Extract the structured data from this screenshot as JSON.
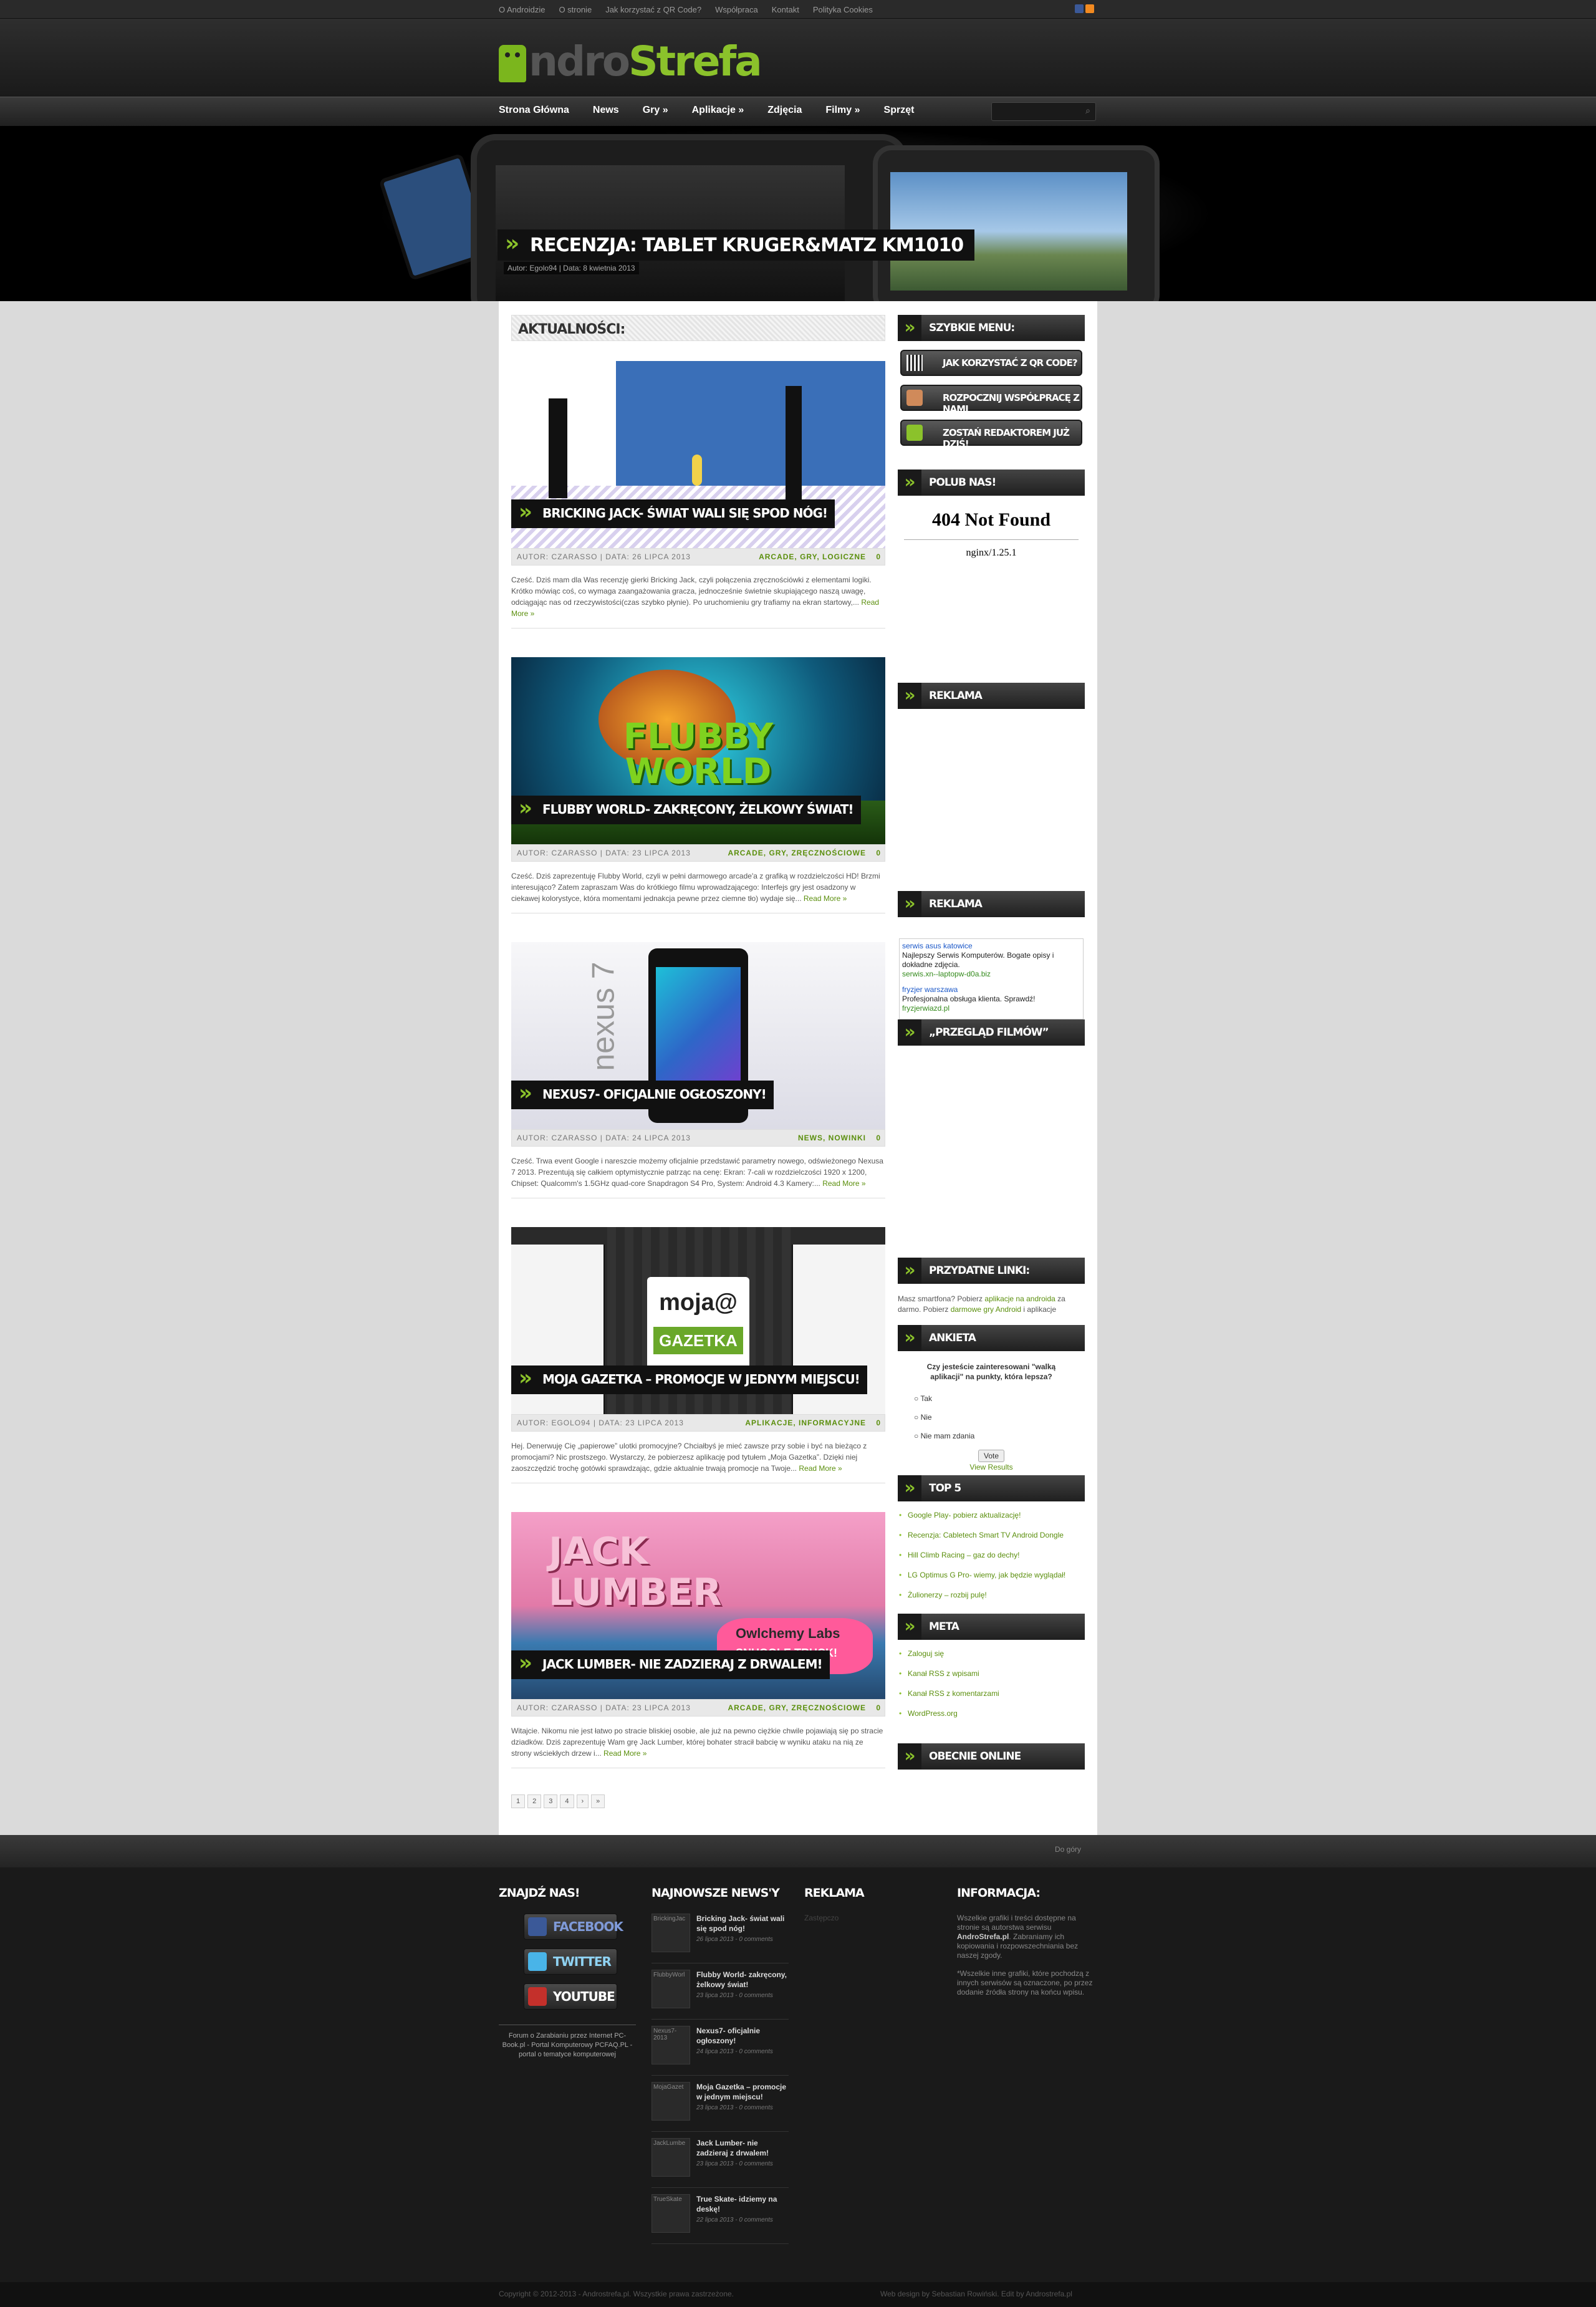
{
  "topbar": {
    "links": [
      "O Androidzie",
      "O stronie",
      "Jak korzystać z QR Code?",
      "Współpraca",
      "Kontakt",
      "Polityka Cookies"
    ]
  },
  "logo": {
    "text_a": "ndro",
    "text_b": "Strefa"
  },
  "nav": {
    "items": [
      "Strona Główna",
      "News",
      "Gry »",
      "Aplikacje »",
      "Zdjęcia",
      "Filmy »",
      "Sprzęt"
    ],
    "search_icon": "search-icon"
  },
  "slider": {
    "title": "Recenzja: Tablet Kruger&Matz KM1010",
    "meta": "Autor: Egolo94 | Data: 8 kwietnia 2013"
  },
  "content": {
    "section_title": "Aktualności:"
  },
  "posts": [
    {
      "title": "Bricking Jack- świat wali się spod nóg!",
      "meta": "Autor: Czarasso | Data: 26 lipca 2013",
      "cats": "Arcade, Gry, Logiczne",
      "comments": "0",
      "excerpt": "Cześć. Dziś mam dla Was recenzję gierki Bricking Jack, czyli połączenia zręcznościówki z elementami logiki. Krótko mówiąc coś, co wymaga zaangażowania gracza, jednocześnie świetnie skupiającego naszą uwagę, odciągając nas od rzeczywistości(czas szybko płynie). Po uruchomieniu gry trafiamy na ekran startowy,...",
      "more": "Read More »"
    },
    {
      "title": "Flubby World- zakręcony, żelkowy świat!",
      "meta": "Autor: Czarasso | Data: 23 lipca 2013",
      "cats": "Arcade, Gry, Zręcznościowe",
      "comments": "0",
      "excerpt": "Cześć. Dziś zaprezentuję Flubby World, czyli w pełni darmowego arcade'a z grafiką w rozdzielczości HD! Brzmi interesująco? Zatem zapraszam Was do krótkiego filmu wprowadzającego: Interfejs gry jest osadzony w ciekawej kolorystyce, która momentami jednakcja pewne przez ciemne tło) wydaje się...",
      "more": "Read More »"
    },
    {
      "title": "Nexus7- oficjalnie ogłoszony!",
      "meta": "Autor: Czarasso | Data: 24 lipca 2013",
      "cats": "News, Nowinki",
      "comments": "0",
      "excerpt": "Cześć. Trwa event Google i nareszcie możemy oficjalnie przedstawić parametry nowego, odświeżonego Nexusa 7 2013. Prezentują się całkiem optymistycznie patrząc na cenę: Ekran: 7-cali w rozdzielczości 1920 x 1200, Chipset: Qualcomm's 1.5GHz quad-core Snapdragon S4 Pro, System: Android 4.3 Kamery:...",
      "more": "Read More »"
    },
    {
      "title": "Moja Gazetka – promocje w jednym miejscu!",
      "meta": "Autor: Egolo94 | Data: 23 lipca 2013",
      "cats": "Aplikacje, Informacyjne",
      "comments": "0",
      "excerpt": "Hej. Denerwuję Cię „papierowe” ulotki promocyjne? Chciałbyś je mieć zawsze przy sobie i być na bieżąco z promocjami? Nic prostszego. Wystarczy, że pobierzesz aplikację pod tytułem „Moja Gazetka”. Dzięki niej zaoszczędzić trochę gotówki sprawdzając, gdzie aktualnie trwają promocje na Twoje...",
      "more": "Read More »"
    },
    {
      "title": "Jack Lumber- nie zadzieraj z drwalem!",
      "meta": "Autor: Czarasso | Data: 23 lipca 2013",
      "cats": "Arcade, Gry, Zręcznościowe",
      "comments": "0",
      "excerpt": "Witajcie. Nikomu nie jest łatwo po stracie bliskiej osobie, ale już na pewno ciężkie chwile pojawiają się po stracie dziadków. Dziś zaprezentuję Wam grę Jack Lumber, której bohater stracił babcię w wyniku ataku na nią ze strony wściekłych drzew i...",
      "more": "Read More »"
    }
  ],
  "post_images": {
    "moja_gazetka_logo": "moja@",
    "moja_gazetka_sub": "GAZETKA",
    "flubby": "FLUBBY WORLD",
    "nexus": "nexus 7",
    "jack_lumber": "JACK LUMBER",
    "owlchemy": "Owlchemy Labs",
    "snuggle": "SNUGGLE TRUCK!"
  },
  "pagination": [
    "1",
    "2",
    "3",
    "4",
    "›",
    "»"
  ],
  "sidebar": {
    "quick_title": "Szybkie menu:",
    "quick_buttons": [
      "Jak korzystać z QR Code?",
      "Rozpocznij współpracę z nami",
      "Zostań redaktorem już dziś!"
    ],
    "like_title": "Polub nas!",
    "err_title": "404 Not Found",
    "err_server": "nginx/1.25.1",
    "ad_title": "Reklama",
    "ad2_title": "Reklama",
    "ads": [
      {
        "t": "serwis asus katowice",
        "d": "Najlepszy Serwis Komputerów. Bogate opisy i dokładne zdjęcia.",
        "u": "serwis.xn--laptopw-d0a.biz"
      },
      {
        "t": "fryzjer warszawa",
        "d": "Profesjonalna obsługa klienta. Sprawdź!",
        "u": "fryzjerwiazd.pl"
      }
    ],
    "films_title": "„Przegląd filmów”",
    "links_title": "Przydatne linki:",
    "links_text_a": "Masz smartfona? Pobierz ",
    "links_link_a": "aplikacje na androida",
    "links_text_b": " za darmo. Pobierz ",
    "links_link_b": "darmowe gry Android",
    "links_text_c": " i aplikacje",
    "poll_title": "Ankieta",
    "poll_question": "Czy jesteście zainteresowani \"walką aplikacji\" na punkty, która lepsza?",
    "poll_options": [
      "Tak",
      "Nie",
      "Nie mam zdania"
    ],
    "poll_vote": "Vote",
    "poll_results": "View Results",
    "top5_title": "Top 5",
    "top5": [
      "Google Play- pobierz aktualizację!",
      "Recenzja: Cabletech Smart TV Android Dongle",
      "Hill Climb Racing – gaz do dechy!",
      "LG Optimus G Pro- wiemy, jak będzie wyglądał!",
      "Żulionerzy – rozbij pulę!"
    ],
    "meta_title": "Meta",
    "meta": [
      "Zaloguj się",
      "Kanał RSS z wpisami",
      "Kanał RSS z komentarzami",
      "WordPress.org"
    ],
    "online_title": "Obecnie online"
  },
  "footer": {
    "to_top": "Do góry",
    "find_title": "Znajdź nas!",
    "social": [
      "Facebook",
      "Twitter",
      "YouTube"
    ],
    "find_note": "Forum o Zarabianiu przez Internet PC-Book.pl - Portal Komputerowy PCFAQ.PL - portal o tematyce komputerowej",
    "news_title": "Najnowsze News'y",
    "news": [
      {
        "thumb": "BrickingJac",
        "t": "Bricking Jack- świat wali się spod nóg!",
        "d": "26 lipca 2013 - 0 comments"
      },
      {
        "thumb": "FlubbyWorl",
        "t": "Flubby World- zakręcony, żelkowy świat!",
        "d": "23 lipca 2013 - 0 comments"
      },
      {
        "thumb": "Nexus7- 2013",
        "t": "Nexus7- oficjalnie ogłoszony!",
        "d": "24 lipca 2013 - 0 comments"
      },
      {
        "thumb": "MojaGazet",
        "t": "Moja Gazetka – promocje w jednym miejscu!",
        "d": "23 lipca 2013 - 0 comments"
      },
      {
        "thumb": "JackLumbe",
        "t": "Jack Lumber- nie zadzieraj z drwalem!",
        "d": "23 lipca 2013 - 0 comments"
      },
      {
        "thumb": "TrueSkate",
        "t": "True Skate- idziemy na deskę!",
        "d": "22 lipca 2013 - 0 comments"
      }
    ],
    "ad_title": "Reklama",
    "ad_text": "Zastępczo",
    "info_title": "Informacja:",
    "info_a1": "Wszelkie grafiki i treści dostępne na stronie są autorstwa serwisu ",
    "info_brand": "AndroStrefa.pl",
    "info_a2": ". Zabraniamy ich kopiowania i rozpowszechniania bez naszej zgody.",
    "info_b": "*Wszelkie inne grafiki, które pochodzą z innych serwisów są oznaczone, po przez dodanie źródła strony na końcu wpisu.",
    "copyright": "Copyright © 2012-2013 - Androstrefa.pl. Wszystkie prawa zastrzeżone.",
    "credit": "Web design by Sebastian Rowiński. Edit by Androstrefa.pl"
  }
}
